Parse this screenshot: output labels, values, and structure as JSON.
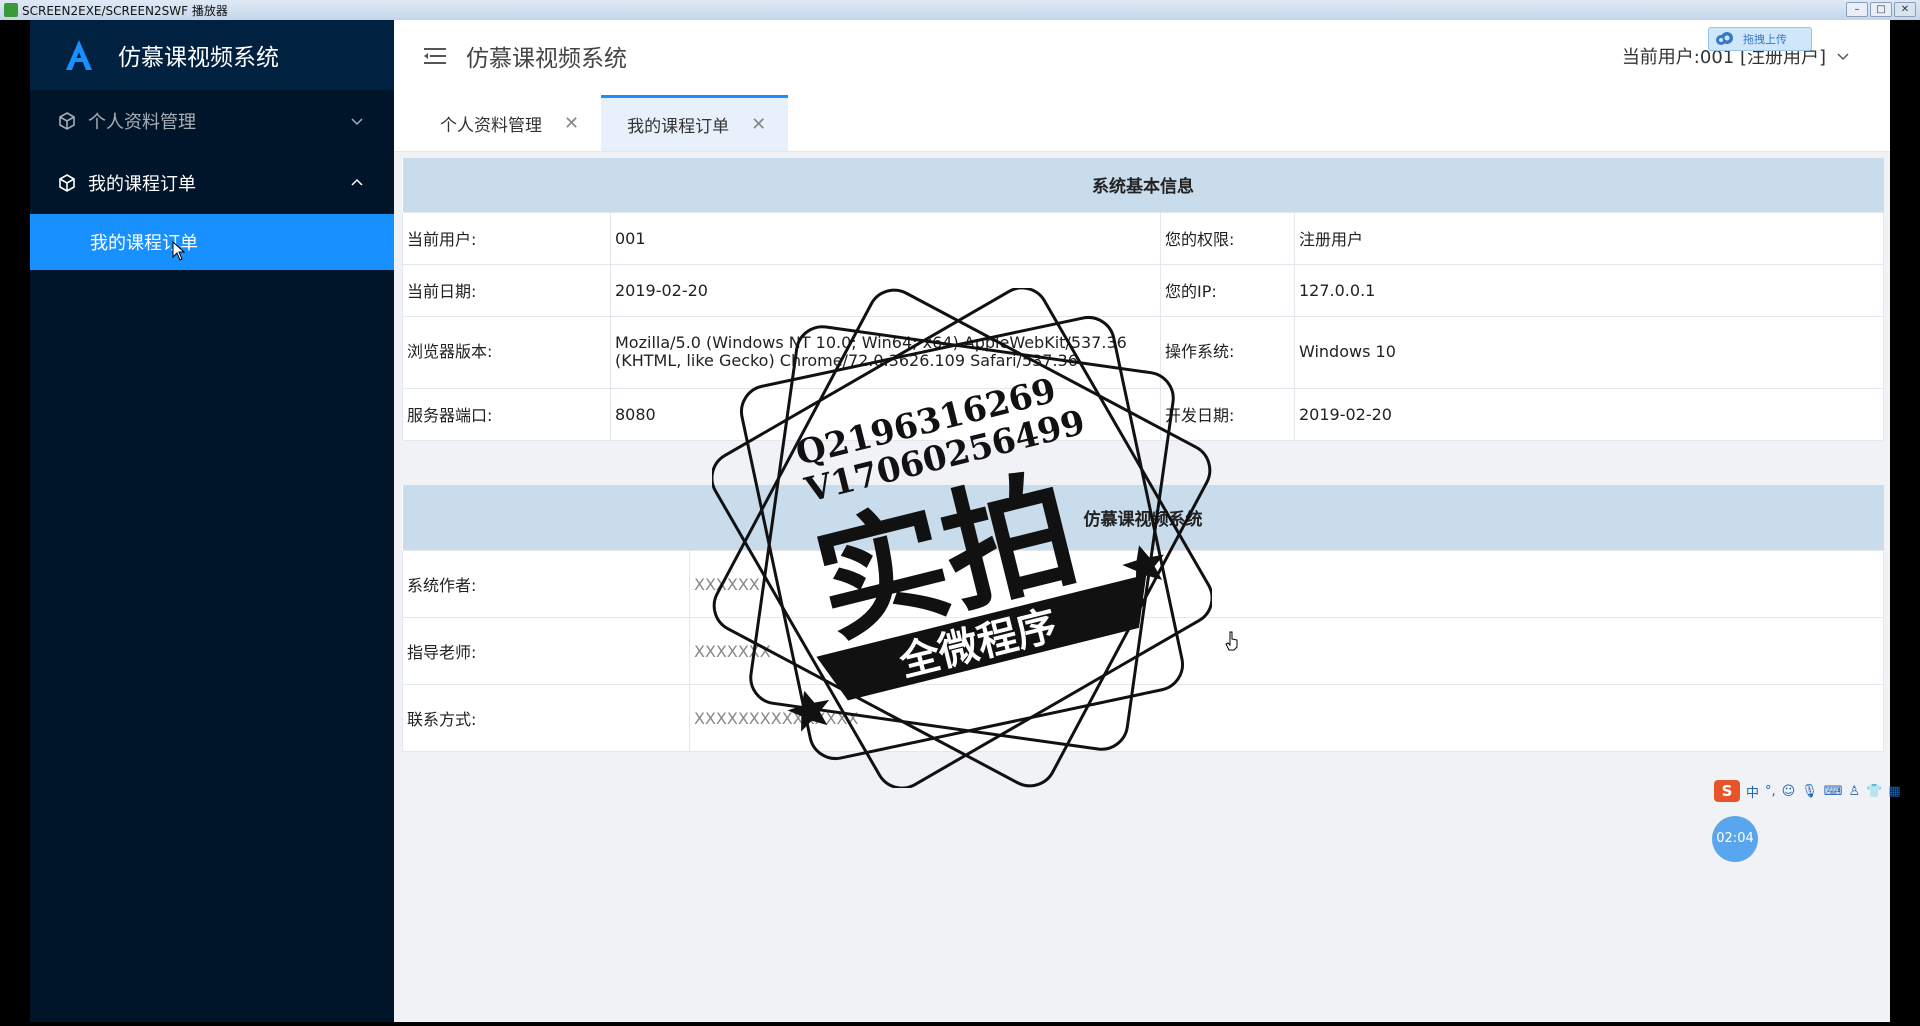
{
  "player": {
    "title": "SCREEN2EXE/SCREEN2SWF 播放器"
  },
  "sidebar": {
    "brand": "仿慕课视频系统",
    "items": [
      {
        "label": "个人资料管理"
      },
      {
        "label": "我的课程订单"
      }
    ],
    "subitem": {
      "label": "我的课程订单"
    }
  },
  "header": {
    "title": "仿慕课视频系统",
    "user": "当前用户:001 [注册用户]"
  },
  "tabs": [
    {
      "label": "个人资料管理"
    },
    {
      "label": "我的课程订单"
    }
  ],
  "sysinfo": {
    "heading": "系统基本信息",
    "current_user_label": "当前用户:",
    "current_user": "001",
    "permission_label": "您的权限:",
    "permission": "注册用户",
    "date_label": "当前日期:",
    "date": "2019-02-20",
    "ip_label": "您的IP:",
    "ip": "127.0.0.1",
    "browser_label": "浏览器版本:",
    "browser": "Mozilla/5.0 (Windows NT 10.0; Win64; x64) AppleWebKit/537.36 (KHTML, like Gecko) Chrome/72.0.3626.109 Safari/537.36",
    "os_label": "操作系统:",
    "os": "Windows 10",
    "port_label": "服务器端口:",
    "port": "8080",
    "dev_date_label": "开发日期:",
    "dev_date": "2019-02-20"
  },
  "about": {
    "heading": "仿慕课视频系统",
    "author_label": "系统作者:",
    "author": "XXXXXX",
    "teacher_label": "指导老师:",
    "teacher": "XXXXXXX",
    "contact_label": "联系方式:",
    "contact": "XXXXXXXXXXXXXXX"
  },
  "stamp": {
    "line1": "Q2196316269",
    "line2": "V17060256499",
    "big": "实拍",
    "banner": "全微程序"
  },
  "overlay": {
    "upload": "拖拽上传",
    "ime_lang": "中",
    "timer": "02:04"
  }
}
